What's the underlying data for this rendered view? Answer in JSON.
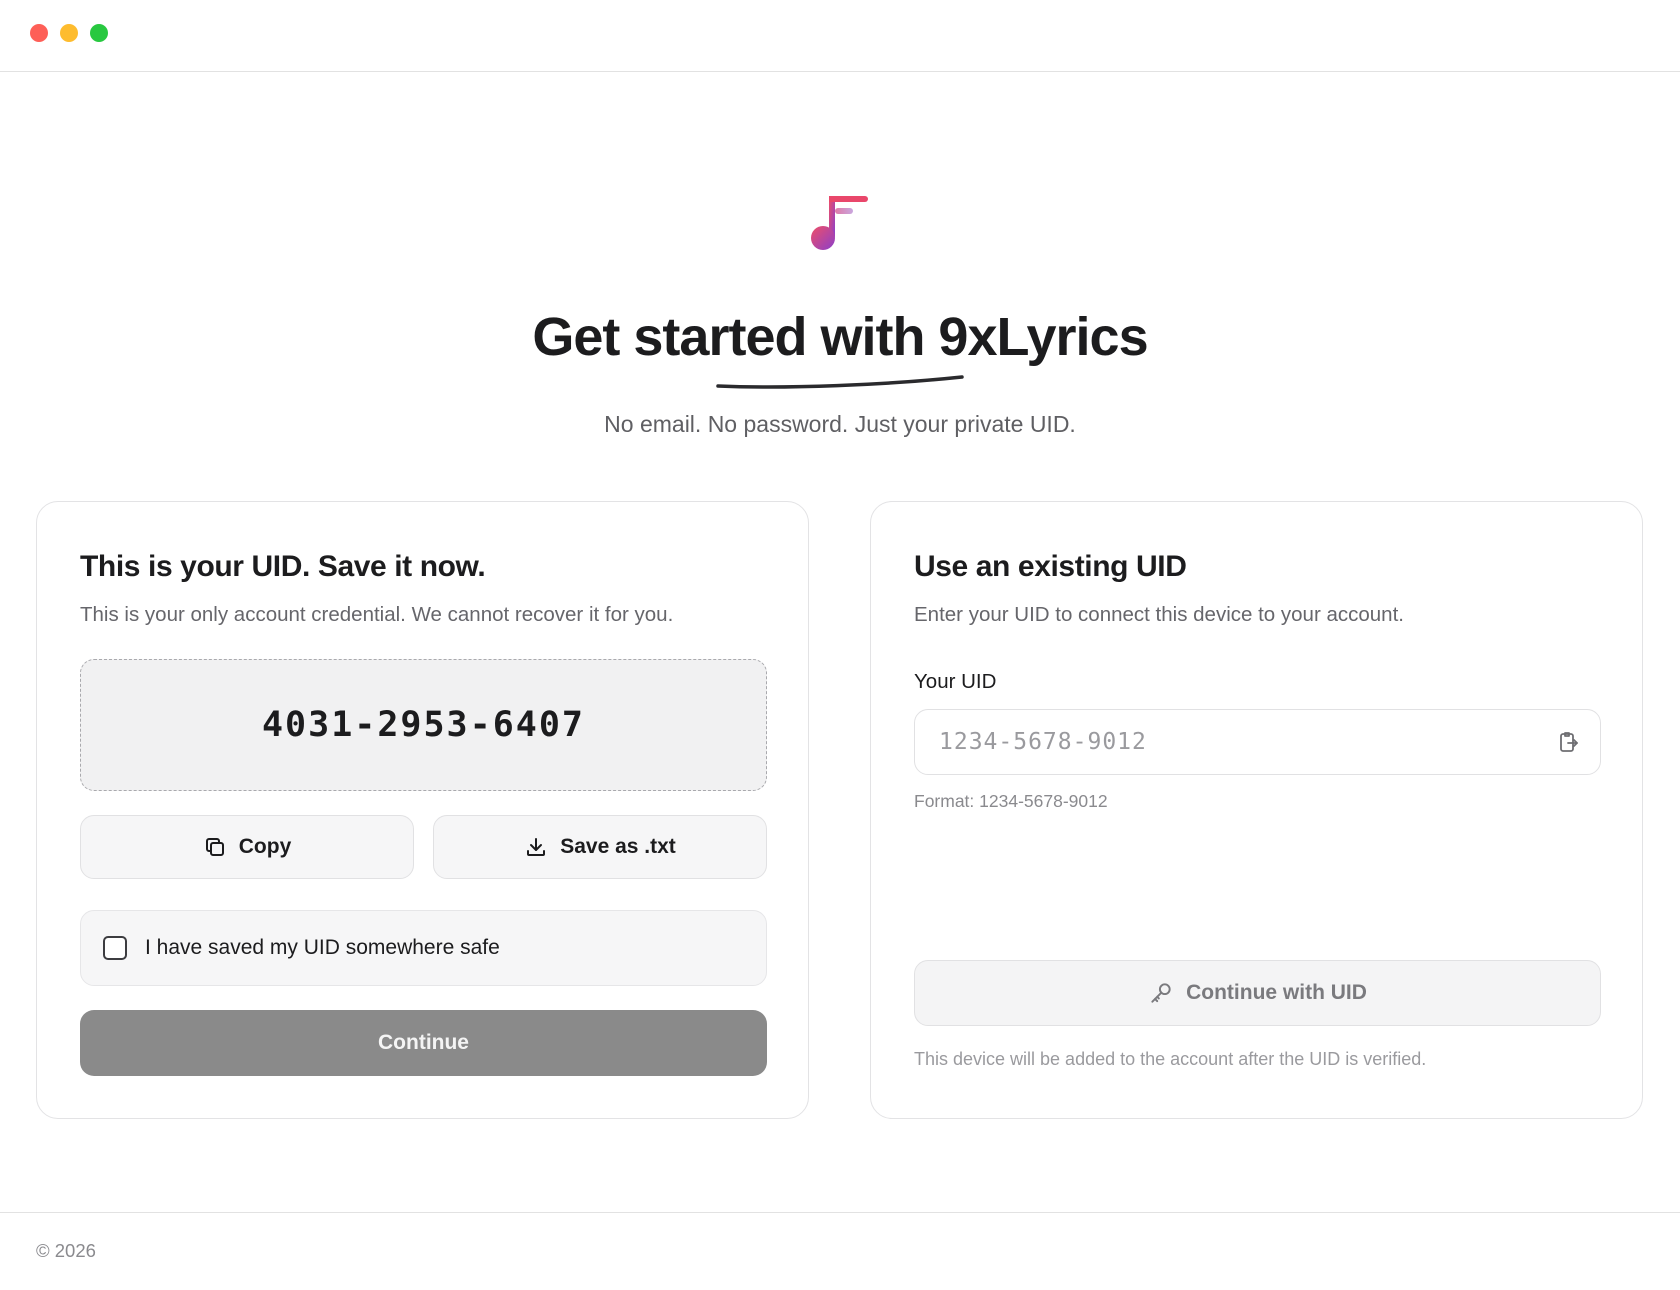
{
  "window": {
    "controls": [
      "close",
      "minimize",
      "zoom"
    ]
  },
  "brand": {
    "logo_icon": "music-note-f-logo-icon",
    "accent_start": "#e8476a",
    "accent_end": "#8a3fc9"
  },
  "header": {
    "title": "Get started with 9xLyrics",
    "subtitle": "No email. No password. Just your private UID."
  },
  "new_uid_card": {
    "title": "This is your UID. Save it now.",
    "description": "This is your only account credential. We cannot recover it for you.",
    "uid": "4031-2953-6407",
    "copy_label": "Copy",
    "copy_icon": "copy-icon",
    "save_label": "Save as .txt",
    "save_icon": "download-icon",
    "confirm_label": "I have saved my UID somewhere safe",
    "confirm_checked": false,
    "continue_label": "Continue"
  },
  "existing_uid_card": {
    "title": "Use an existing UID",
    "description": "Enter your UID to connect this device to your account.",
    "field_label": "Your UID",
    "input_value": "",
    "input_placeholder": "1234-5678-9012",
    "paste_icon": "clipboard-paste-icon",
    "format_hint": "Format: 1234-5678-9012",
    "submit_label": "Continue with UID",
    "submit_icon": "key-icon",
    "note": "This device will be added to the account after the UID is verified."
  },
  "footer": {
    "copyright": "© 2026"
  }
}
